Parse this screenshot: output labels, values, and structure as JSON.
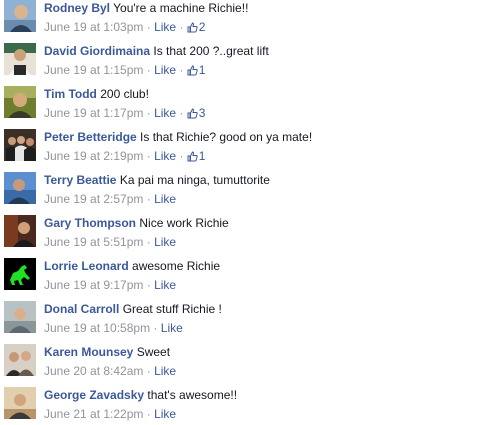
{
  "comments": [
    {
      "author": "Rodney Byl",
      "text": "You're a machine Richie!!",
      "date": "June 19 at 1:03pm",
      "like_label": "Like",
      "likes": "2",
      "avatar_icon": "profile-photo-icon",
      "avatar_color": "#6a8caf"
    },
    {
      "author": "David Giordimaina",
      "text": "Is that 200 ?..great lift",
      "date": "June 19 at 1:15pm",
      "like_label": "Like",
      "likes": "1",
      "avatar_icon": "profile-photo-icon",
      "avatar_color": "#c9b89a"
    },
    {
      "author": "Tim Todd",
      "text": "200 club!",
      "date": "June 19 at 1:17pm",
      "like_label": "Like",
      "likes": "3",
      "avatar_icon": "profile-photo-icon",
      "avatar_color": "#7a8a3a"
    },
    {
      "author": "Peter Betteridge",
      "text": "Is that Richie? good on ya mate!",
      "date": "June 19 at 2:19pm",
      "like_label": "Like",
      "likes": "1",
      "avatar_icon": "profile-photo-icon",
      "avatar_color": "#5a4a3a"
    },
    {
      "author": "Terry Beattie",
      "text": "Ka pai ma ninga, tumuttorite",
      "date": "June 19 at 2:57pm",
      "like_label": "Like",
      "likes": "",
      "avatar_icon": "profile-photo-icon",
      "avatar_color": "#4a7ab8"
    },
    {
      "author": "Gary Thompson",
      "text": "Nice work Richie",
      "date": "June 19 at 5:51pm",
      "like_label": "Like",
      "likes": "",
      "avatar_icon": "profile-photo-icon",
      "avatar_color": "#6a3a2a"
    },
    {
      "author": "Lorrie Leonard",
      "text": "awesome Richie",
      "date": "June 19 at 9:17pm",
      "like_label": "Like",
      "likes": "",
      "avatar_icon": "green-horse-icon",
      "avatar_color": "#000000"
    },
    {
      "author": "Donal Carroll",
      "text": "Great stuff Richie !",
      "date": "June 19 at 10:58pm",
      "like_label": "Like",
      "likes": "",
      "avatar_icon": "profile-photo-icon",
      "avatar_color": "#9aa6a8"
    },
    {
      "author": "Karen Mounsey",
      "text": "Sweet",
      "date": "June 20 at 8:42am",
      "like_label": "Like",
      "likes": "",
      "avatar_icon": "profile-photo-icon",
      "avatar_color": "#8a7a6a"
    },
    {
      "author": "George Zavadsky",
      "text": "that's awesome!!",
      "date": "June 21 at 1:22pm",
      "like_label": "Like",
      "likes": "",
      "avatar_icon": "profile-photo-icon",
      "avatar_color": "#b89a6a"
    }
  ],
  "separator": "·",
  "colors": {
    "link": "#3b5998",
    "meta": "#90949c",
    "text": "#141823"
  }
}
